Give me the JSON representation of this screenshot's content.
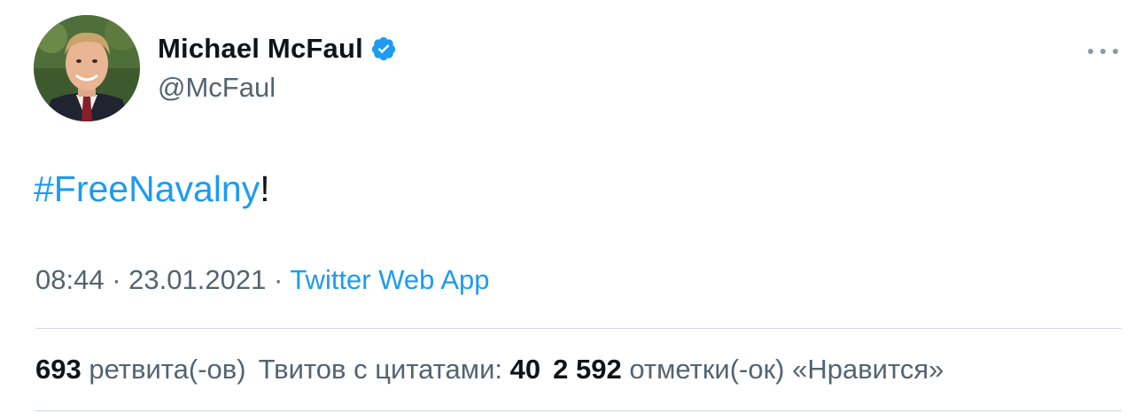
{
  "author": {
    "display_name": "Michael McFaul",
    "handle": "@McFaul",
    "verified_icon": "verified-badge-icon",
    "avatar_icon": "avatar"
  },
  "tweet": {
    "hashtag": "#FreeNavalny",
    "text_suffix": "!",
    "time": "08:44",
    "separator": "·",
    "date": "23.01.2021",
    "source": "Twitter Web App"
  },
  "stats": {
    "retweets_count": "693",
    "retweets_label": "ретвита(-ов)",
    "quotes_label": "Твитов с цитатами:",
    "quotes_count": "40",
    "likes_count": "2 592",
    "likes_label": "отметки(-ок) «Нравится»"
  },
  "colors": {
    "accent": "#1d9bf0",
    "text": "#0f1419",
    "secondary": "#536471"
  }
}
